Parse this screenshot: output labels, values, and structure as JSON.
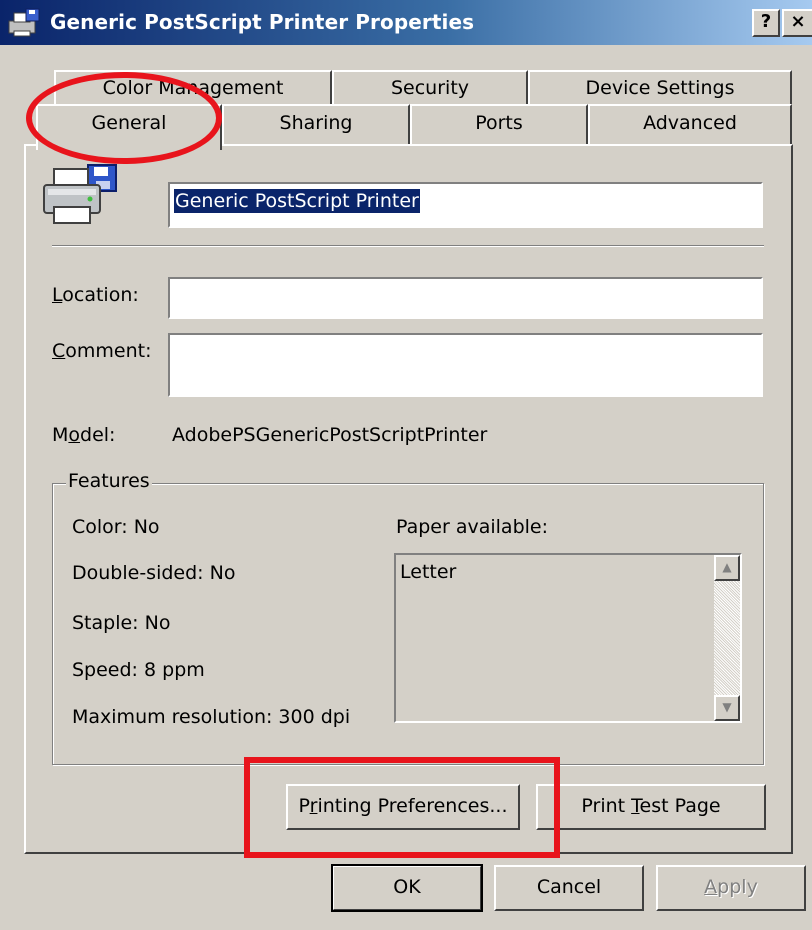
{
  "window": {
    "title": "Generic PostScript Printer Properties",
    "help_label": "?",
    "close_label": "×"
  },
  "tabs": {
    "row1": [
      "Color Management",
      "Security",
      "Device Settings"
    ],
    "row2": [
      "General",
      "Sharing",
      "Ports",
      "Advanced"
    ],
    "active": "General"
  },
  "general": {
    "printer_name": "Generic PostScript Printer",
    "location_label": "Location:",
    "location_value": "",
    "comment_label": "Comment:",
    "comment_value": "",
    "model_label": "Model:",
    "model_value": "AdobePSGenericPostScriptPrinter"
  },
  "features": {
    "legend": "Features",
    "color": "Color: No",
    "double_sided": "Double-sided: No",
    "staple": "Staple: No",
    "speed": "Speed: 8 ppm",
    "max_resolution": "Maximum resolution: 300 dpi",
    "paper_label": "Paper available:",
    "paper_items": [
      "Letter"
    ]
  },
  "buttons": {
    "printing_preferences": "Printing Preferences...",
    "print_test_page": "Print Test Page",
    "ok": "OK",
    "cancel": "Cancel",
    "apply": "Apply"
  },
  "annotation_color": "#e8141c",
  "title_bar_color": "#0a246a"
}
